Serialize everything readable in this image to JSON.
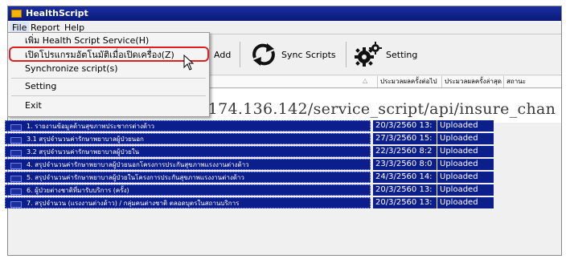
{
  "window": {
    "title": "HealthScript"
  },
  "menubar": {
    "items": [
      "File",
      "Report",
      "Help"
    ]
  },
  "file_menu": {
    "items": [
      "เพิ่ม Health Script Service(H)",
      "เปิดโปรแกรมอัตโนมัติเมื่อเปิดเครื่อง(Z)",
      "Synchronize script(s)",
      "Setting",
      "Exit"
    ]
  },
  "toolbar": {
    "add_label": "Add",
    "sync_label": "Sync Scripts",
    "setting_label": "Setting"
  },
  "grid": {
    "columns": [
      "ประมวลผลครั้งต่อไป",
      "ประมวลผลครั้งล่าสุด",
      "สถานะ"
    ],
    "url": "8.174.136.142/service_script/api/insure_chan",
    "rows": [
      {
        "name": "1. รายงานข้อมูลด้านสุขภาพประชากรต่างด้าว",
        "date": "20/3/2560 13:",
        "status": "Uploaded"
      },
      {
        "name": "3.1 สรุปจำนวนค่ารักษาพยาบาลผู้ป่วยนอก",
        "date": "27/3/2560 15:",
        "status": "Uploaded"
      },
      {
        "name": "3.2 สรุปจำนวนค่ารักษาพยาบาลผู้ป่วยใน",
        "date": "22/3/2560 8:2",
        "status": "Uploaded"
      },
      {
        "name": "4. สรุปจำนวนค่ารักษาพยาบาลผู้ป่วยนอกโครงการประกันสุขภาพแรงงานต่างด้าว",
        "date": "23/3/2560 8:0",
        "status": "Uploaded"
      },
      {
        "name": "5. สรุปจำนวนค่ารักษาพยาบาลผู้ป่วยในโครงการประกันสุขภาพแรงงานต่างด้าว",
        "date": "24/3/2560 14:",
        "status": "Uploaded"
      },
      {
        "name": "6. ผู้ป่วยต่างชาติที่มารับบริการ (ครั้ง)",
        "date": "20/3/2560 13:",
        "status": "Uploaded"
      },
      {
        "name": "7. สรุปจำนวน (แรงงานต่างด้าว) / กลุ่มคนต่างชาติ ตลอดบุตรในสถานบริการ",
        "date": "20/3/2560 13:",
        "status": "Uploaded"
      }
    ]
  },
  "colors": {
    "selection": "#0b1e8c",
    "title_bar": "#1c2e9e",
    "highlight_ring": "#e02020"
  },
  "icons": [
    "app-icon",
    "add-icon",
    "sync-icon",
    "gear-icon",
    "mouse-cursor-icon"
  ]
}
